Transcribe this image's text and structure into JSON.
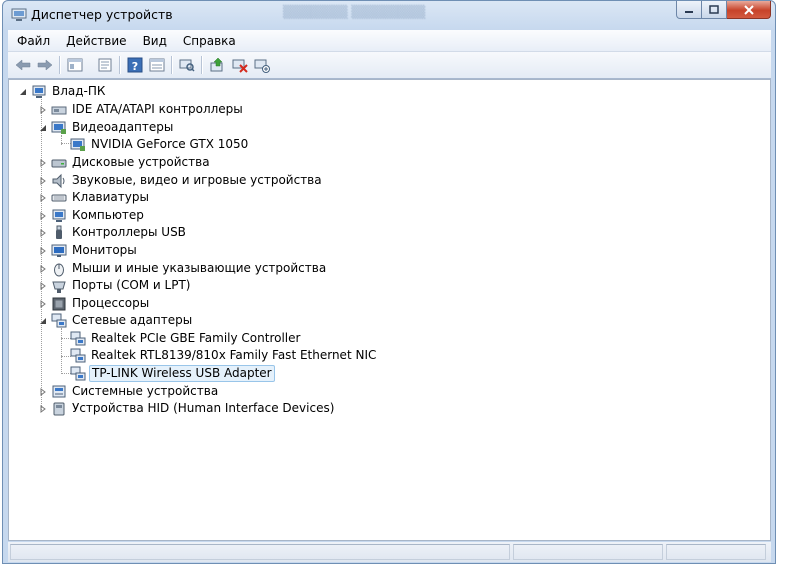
{
  "window": {
    "title": "Диспетчер устройств"
  },
  "menu": [
    "Файл",
    "Действие",
    "Вид",
    "Справка"
  ],
  "toolbar_icons": [
    "back-icon",
    "forward-icon",
    "show-hide-tree-icon",
    "properties-icon",
    "help-icon",
    "view-icon",
    "scan-hardware-icon",
    "update-driver-icon",
    "disable-device-icon",
    "uninstall-device-icon"
  ],
  "tree": {
    "root": "Влад-ПК",
    "categories": [
      {
        "label": "IDE ATA/ATAPI контроллеры",
        "icon": "ide-controller-icon",
        "expanded": false
      },
      {
        "label": "Видеоадаптеры",
        "icon": "display-adapter-icon",
        "expanded": true,
        "children": [
          "NVIDIA GeForce GTX 1050"
        ]
      },
      {
        "label": "Дисковые устройства",
        "icon": "disk-drive-icon",
        "expanded": false
      },
      {
        "label": "Звуковые, видео и игровые устройства",
        "icon": "speaker-icon",
        "expanded": false
      },
      {
        "label": "Клавиатуры",
        "icon": "keyboard-icon",
        "expanded": false
      },
      {
        "label": "Компьютер",
        "icon": "computer-icon",
        "expanded": false
      },
      {
        "label": "Контроллеры USB",
        "icon": "usb-icon",
        "expanded": false
      },
      {
        "label": "Мониторы",
        "icon": "monitor-icon",
        "expanded": false
      },
      {
        "label": "Мыши и иные указывающие устройства",
        "icon": "mouse-icon",
        "expanded": false
      },
      {
        "label": "Порты (COM и LPT)",
        "icon": "port-icon",
        "expanded": false
      },
      {
        "label": "Процессоры",
        "icon": "processor-icon",
        "expanded": false
      },
      {
        "label": "Сетевые адаптеры",
        "icon": "network-adapter-icon",
        "expanded": true,
        "children": [
          "Realtek PCIe GBE Family Controller",
          "Realtek RTL8139/810x Family Fast Ethernet NIC",
          "TP-LINK Wireless USB Adapter"
        ],
        "selected_child": 2
      },
      {
        "label": "Системные устройства",
        "icon": "system-device-icon",
        "expanded": false
      },
      {
        "label": "Устройства HID (Human Interface Devices)",
        "icon": "hid-icon",
        "expanded": false
      }
    ]
  },
  "colors": {
    "selection_bg": "#e5f1fb",
    "selection_border": "#99c5e9",
    "close_button": "#c7432a",
    "window_frame": "#c6d8ee"
  }
}
